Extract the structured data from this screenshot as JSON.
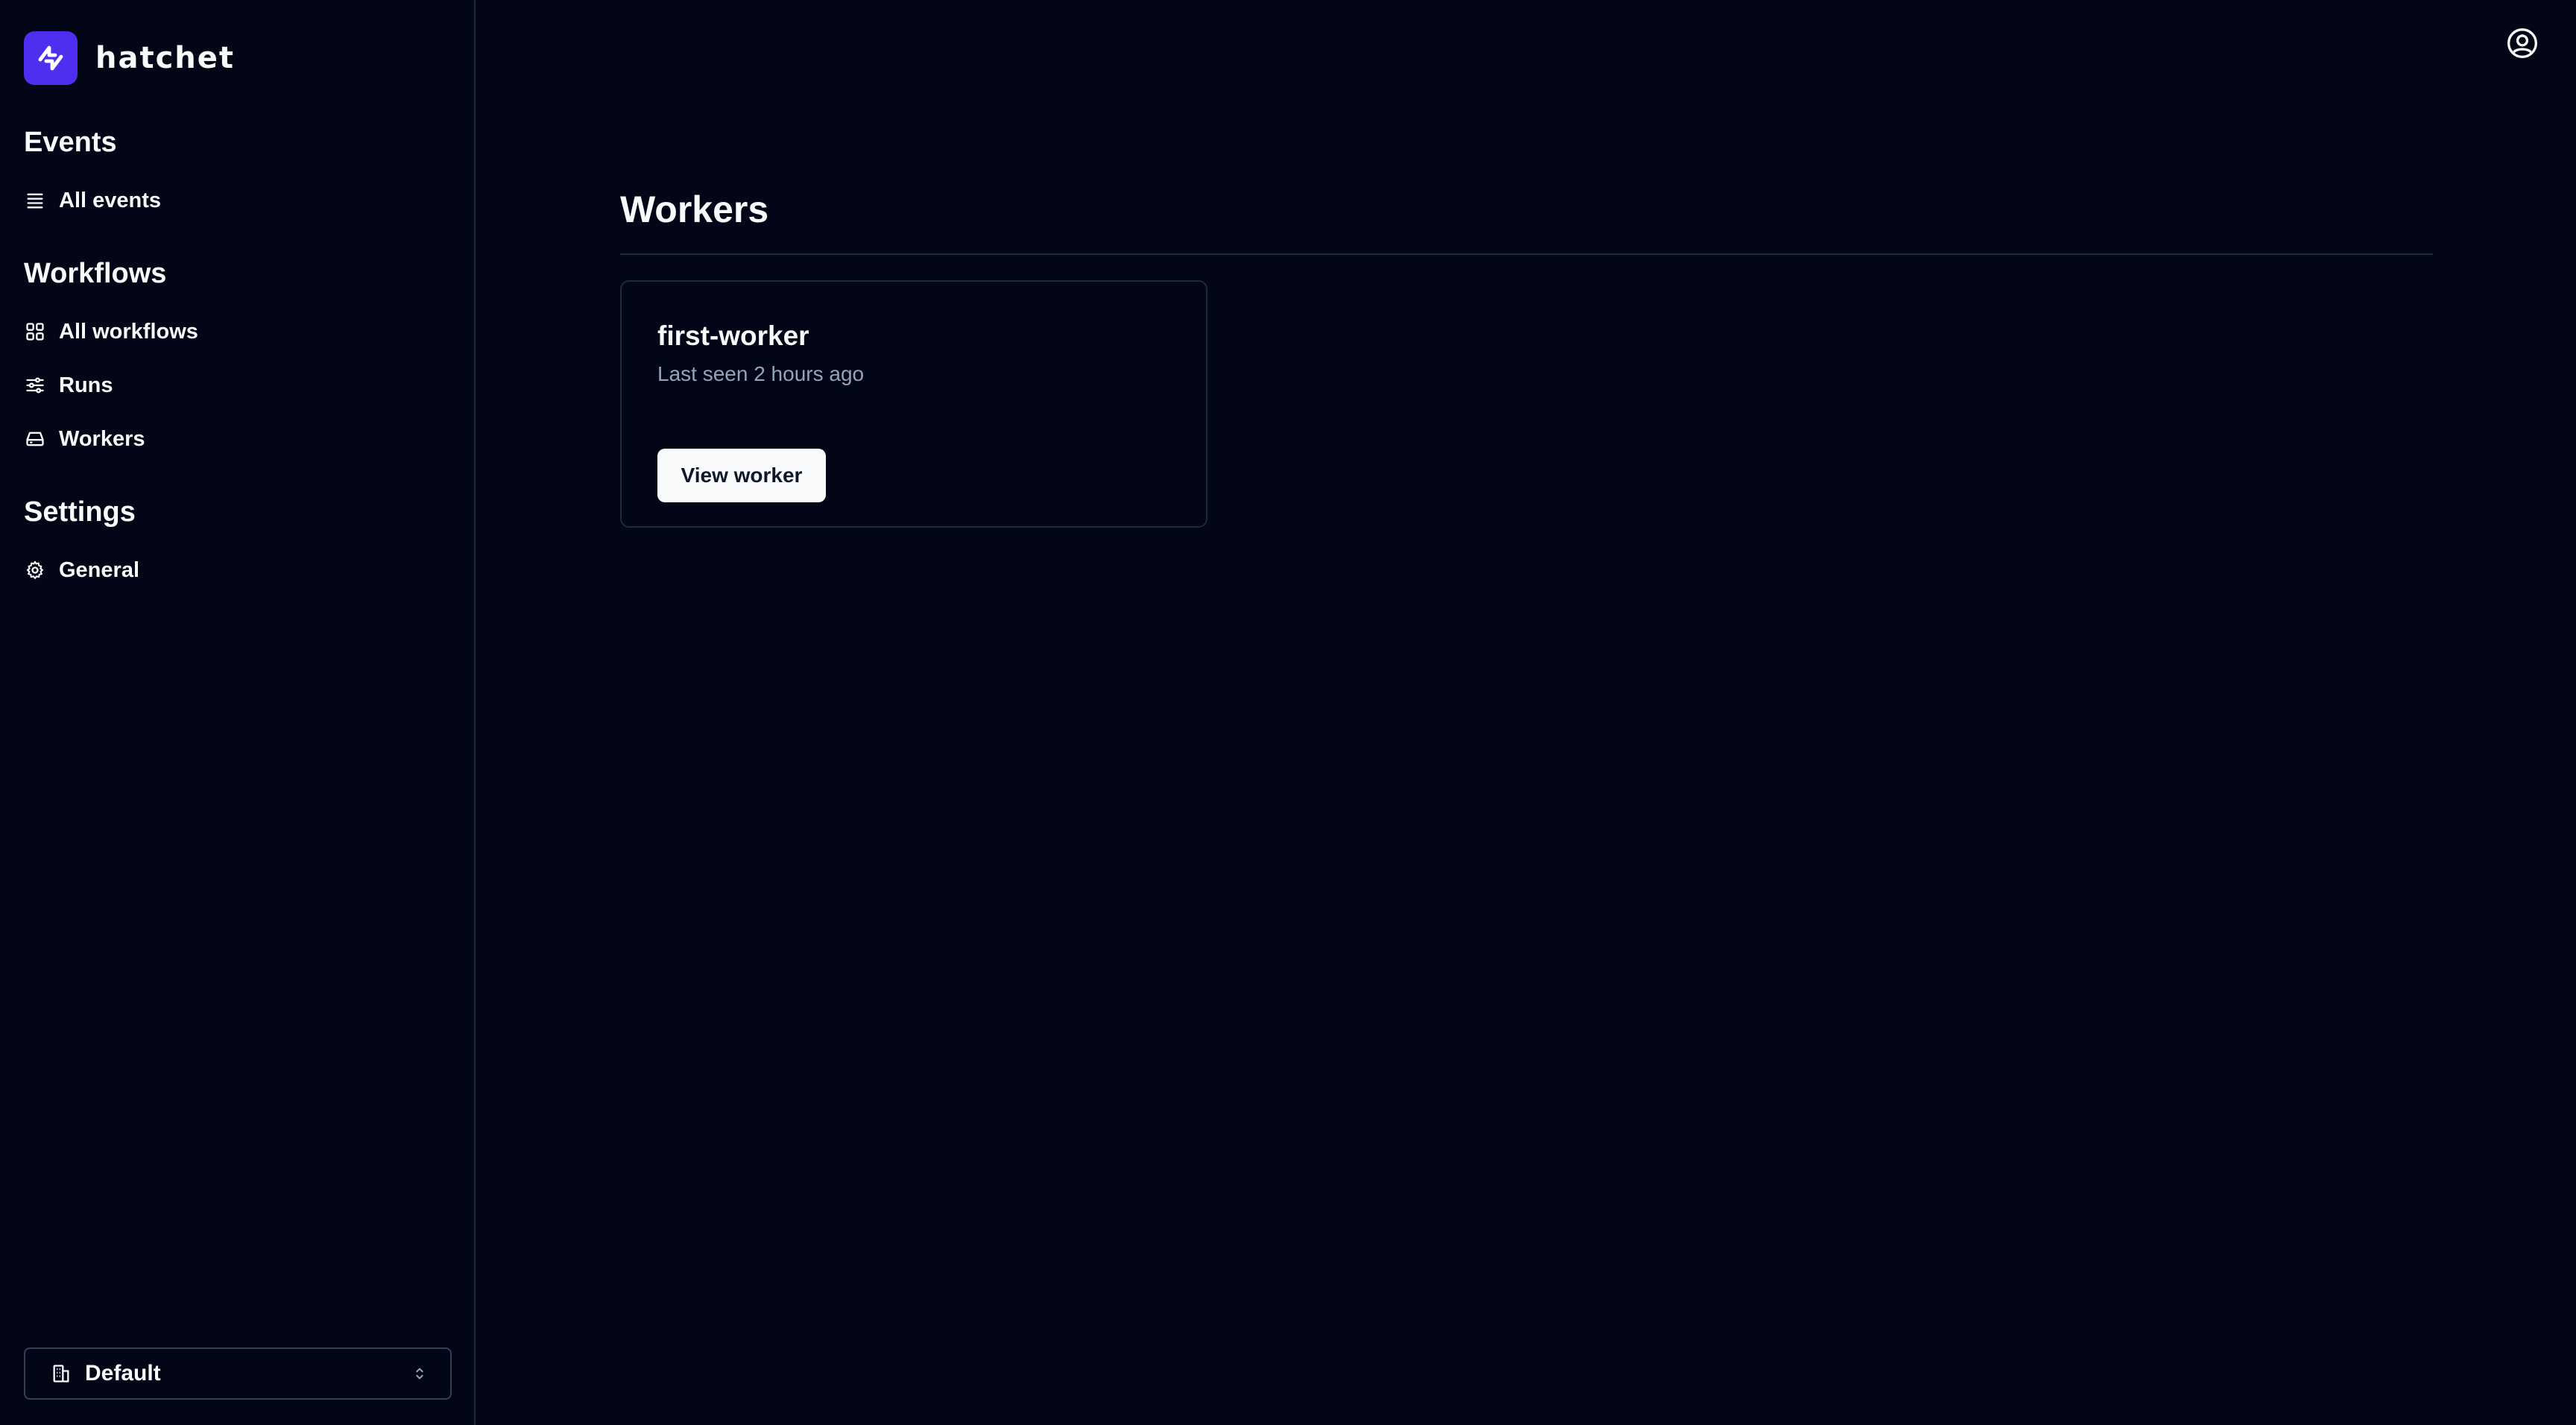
{
  "brand": {
    "name": "hatchet",
    "accent_color": "#4f2ef0"
  },
  "sidebar": {
    "sections": [
      {
        "title": "Events",
        "items": [
          {
            "label": "All events",
            "icon": "list-icon"
          }
        ]
      },
      {
        "title": "Workflows",
        "items": [
          {
            "label": "All workflows",
            "icon": "grid-icon"
          },
          {
            "label": "Runs",
            "icon": "sliders-icon"
          },
          {
            "label": "Workers",
            "icon": "server-icon"
          }
        ]
      },
      {
        "title": "Settings",
        "items": [
          {
            "label": "General",
            "icon": "gear-icon"
          }
        ]
      }
    ],
    "tenant_select": {
      "value": "Default",
      "icon": "building-icon"
    }
  },
  "header": {
    "avatar_icon": "user-circle-icon"
  },
  "main": {
    "title": "Workers",
    "workers": [
      {
        "name": "first-worker",
        "last_seen": "Last seen 2 hours ago",
        "action_label": "View worker"
      }
    ]
  }
}
